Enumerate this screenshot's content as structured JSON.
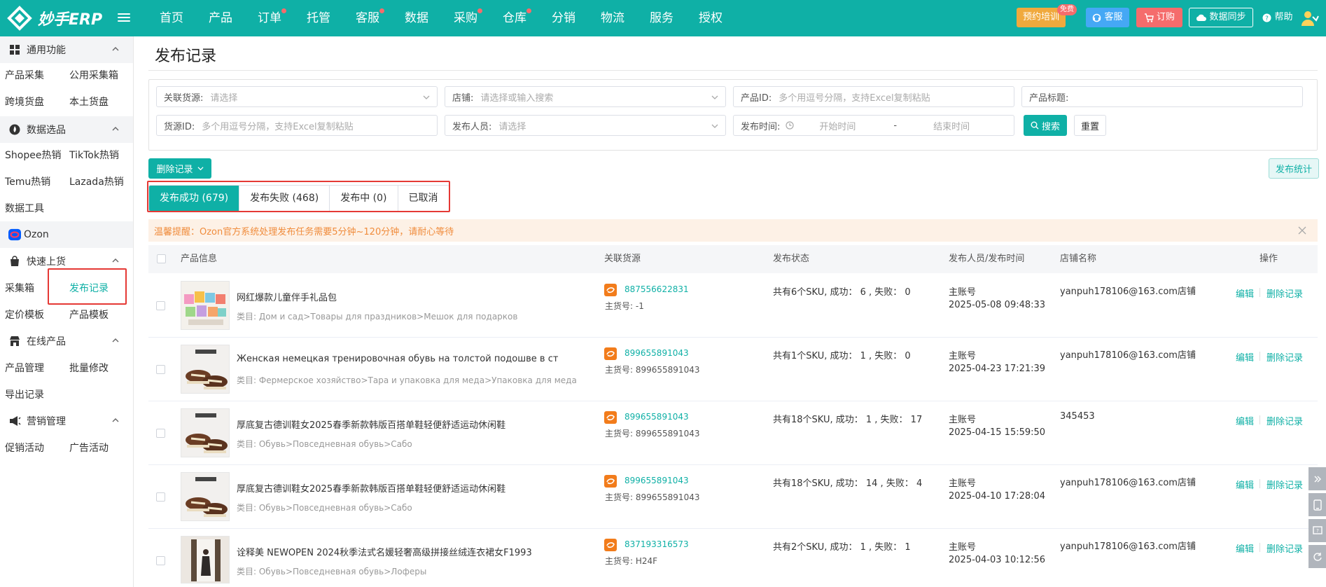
{
  "topbar": {
    "brand": "妙手ERP",
    "nav": [
      {
        "label": "首页",
        "dot": false
      },
      {
        "label": "产品",
        "dot": false
      },
      {
        "label": "订单",
        "dot": true
      },
      {
        "label": "托管",
        "dot": false
      },
      {
        "label": "客服",
        "dot": true
      },
      {
        "label": "数据",
        "dot": false
      },
      {
        "label": "采购",
        "dot": true
      },
      {
        "label": "仓库",
        "dot": true
      },
      {
        "label": "分销",
        "dot": false
      },
      {
        "label": "物流",
        "dot": false
      },
      {
        "label": "服务",
        "dot": false
      },
      {
        "label": "授权",
        "dot": false
      }
    ],
    "training_label": "预约培训",
    "free_badge": "免费",
    "service_label": "客服",
    "order_label": "订购",
    "sync_label": "数据同步",
    "help_label": "帮助",
    "colors": {
      "bar": "#0fb0a6",
      "training": "#f0a93d",
      "service": "#45a8f5",
      "order": "#f56c6c"
    }
  },
  "sidebar": {
    "sections": [
      {
        "title": "通用功能",
        "icon": "grid-icon",
        "links": [
          "产品采集",
          "公用采集箱",
          "跨境货盘",
          "本土货盘"
        ]
      },
      {
        "title": "数据选品",
        "icon": "flame-icon",
        "links": [
          "Shopee热销",
          "TikTok热销",
          "Temu热销",
          "Lazada热销",
          "数据工具"
        ]
      },
      {
        "title": "Ozon",
        "icon": "ozon-logo-icon",
        "links": []
      },
      {
        "title": "快速上货",
        "icon": "bag-icon",
        "links": [
          "采集箱",
          "发布记录",
          "定价模板",
          "产品模板"
        ]
      },
      {
        "title": "在线产品",
        "icon": "store-icon",
        "links": [
          "产品管理",
          "批量修改",
          "导出记录"
        ]
      },
      {
        "title": "营销管理",
        "icon": "megaphone-icon",
        "links": [
          "促销活动",
          "广告活动"
        ]
      }
    ],
    "active_link": "发布记录"
  },
  "page": {
    "title": "发布记录"
  },
  "filters": {
    "source": {
      "label": "关联货源:",
      "placeholder": "请选择"
    },
    "shop": {
      "label": "店铺:",
      "placeholder": "请选择或输入搜索"
    },
    "product_id": {
      "label": "产品ID:",
      "placeholder": "多个用逗号分隔，支持Excel复制粘贴"
    },
    "product_title": {
      "label": "产品标题:",
      "placeholder": ""
    },
    "source_id": {
      "label": "货源ID:",
      "placeholder": "多个用逗号分隔，支持Excel复制粘贴"
    },
    "publisher": {
      "label": "发布人员:",
      "placeholder": "请选择"
    },
    "publish_time": {
      "label": "发布时间:",
      "start_placeholder": "开始时间",
      "separator": "-",
      "end_placeholder": "结束时间"
    },
    "search_label": "搜索",
    "reset_label": "重置"
  },
  "actions": {
    "delete_label": "删除记录",
    "stats_label": "发布统计"
  },
  "tabs": [
    {
      "label": "发布成功 (679)",
      "active": true
    },
    {
      "label": "发布失败 (468)",
      "active": false
    },
    {
      "label": "发布中 (0)",
      "active": false
    },
    {
      "label": "已取消",
      "active": false
    }
  ],
  "notice": "温馨提醒：Ozon官方系统处理发布任务需要5分钟~120分钟，请耐心等待",
  "table": {
    "headers": {
      "product": "产品信息",
      "source": "关联货源",
      "status": "发布状态",
      "publisher": "发布人员/发布时间",
      "shop": "店铺名称",
      "ops": "操作"
    },
    "rows": [
      {
        "name": "网红爆款儿童伴手礼品包",
        "category": "类目: Дом и сад>Товары для праздников>Мешок для подарков",
        "source_id": "887556622831",
        "main_sku": "主货号: -1",
        "status": "共有6个SKU, 成功： 6 , 失败： 0",
        "publisher": "主账号",
        "time": "2025-05-08 09:48:33",
        "shop": "yanpuh178106@163.com店铺",
        "edit": "编辑",
        "delete": "删除记录"
      },
      {
        "name": "Женская немецкая тренировочная обувь на толстой подошве в ст",
        "category": "类目: Фермерское хозяйство>Тара и упаковка для меда>Упаковка для меда",
        "source_id": "899655891043",
        "main_sku": "主货号: 899655891043",
        "status": "共有1个SKU, 成功： 1 , 失败： 0",
        "publisher": "主账号",
        "time": "2025-04-23 17:21:39",
        "shop": "yanpuh178106@163.com店铺",
        "edit": "编辑",
        "delete": "删除记录"
      },
      {
        "name": "厚底复古德训鞋女2025春季新款韩版百搭单鞋轻便舒适运动休闲鞋",
        "category": "类目: Обувь>Повседневная обувь>Сабо",
        "source_id": "899655891043",
        "main_sku": "主货号: 899655891043",
        "status": "共有18个SKU, 成功： 1 , 失败： 17",
        "publisher": "主账号",
        "time": "2025-04-15 15:59:50",
        "shop": "345453",
        "edit": "编辑",
        "delete": "删除记录"
      },
      {
        "name": "厚底复古德训鞋女2025春季新款韩版百搭单鞋轻便舒适运动休闲鞋",
        "category": "类目: Обувь>Повседневная обувь>Сабо",
        "source_id": "899655891043",
        "main_sku": "主货号: 899655891043",
        "status": "共有18个SKU, 成功： 14 , 失败： 4",
        "publisher": "主账号",
        "time": "2025-04-10 17:28:04",
        "shop": "yanpuh178106@163.com店铺",
        "edit": "编辑",
        "delete": "删除记录"
      },
      {
        "name": "诠释美 NEWOPEN 2024秋季法式名媛轻奢高级拼接丝绒连衣裙女F1993",
        "category": "类目: Обувь>Повседневная обувь>Лоферы",
        "source_id": "837193316573",
        "main_sku": "主货号: H24F",
        "status": "共有2个SKU, 成功： 1 , 失败： 1",
        "publisher": "主账号",
        "time": "2025-04-03 10:12:56",
        "shop": "yanpuh178106@163.com店铺",
        "edit": "编辑",
        "delete": "删除记录"
      }
    ]
  }
}
